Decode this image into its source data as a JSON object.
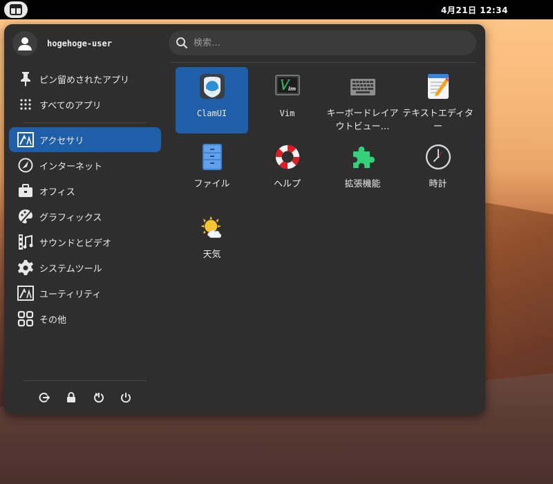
{
  "topbar": {
    "clock": "4月21日  12:34",
    "activities_icon": "activities-icon"
  },
  "user": {
    "name": "hogehoge-user",
    "avatar_icon": "user-avatar-icon"
  },
  "search": {
    "placeholder": "検索…"
  },
  "sidebar": {
    "pinned": [
      {
        "label": "ピン留めされたアプリ",
        "icon": "pin-icon"
      },
      {
        "label": "すべてのアプリ",
        "icon": "grid-dots-icon"
      }
    ],
    "categories": [
      {
        "label": "アクセサリ",
        "icon": "accessories-icon",
        "active": true
      },
      {
        "label": "インターネット",
        "icon": "internet-icon"
      },
      {
        "label": "オフィス",
        "icon": "office-icon"
      },
      {
        "label": "グラフィックス",
        "icon": "graphics-icon"
      },
      {
        "label": "サウンドとビデオ",
        "icon": "sound-video-icon"
      },
      {
        "label": "システムツール",
        "icon": "gear-icon"
      },
      {
        "label": "ユーティリティ",
        "icon": "utilities-icon"
      },
      {
        "label": "その他",
        "icon": "other-icon"
      }
    ]
  },
  "footer": {
    "buttons": [
      "logout-icon",
      "lock-icon",
      "restart-icon",
      "power-icon"
    ]
  },
  "apps": [
    {
      "label": "ClamUI",
      "icon": "clamui-icon",
      "active": true,
      "mono": true
    },
    {
      "label": "Vim",
      "icon": "vim-icon",
      "mono": true
    },
    {
      "label": "キーボードレイアウトビュー…",
      "icon": "keyboard-icon"
    },
    {
      "label": "テキストエディター",
      "icon": "text-editor-icon"
    },
    {
      "label": "ファイル",
      "icon": "files-icon"
    },
    {
      "label": "ヘルプ",
      "icon": "help-lifebuoy-icon"
    },
    {
      "label": "拡張機能",
      "icon": "puzzle-icon"
    },
    {
      "label": "時計",
      "icon": "clock-icon"
    },
    {
      "label": "天気",
      "icon": "weather-icon"
    }
  ],
  "colors": {
    "accent": "#1f5ea8",
    "panel": "#2e2e2e",
    "topbar": "#000000"
  }
}
